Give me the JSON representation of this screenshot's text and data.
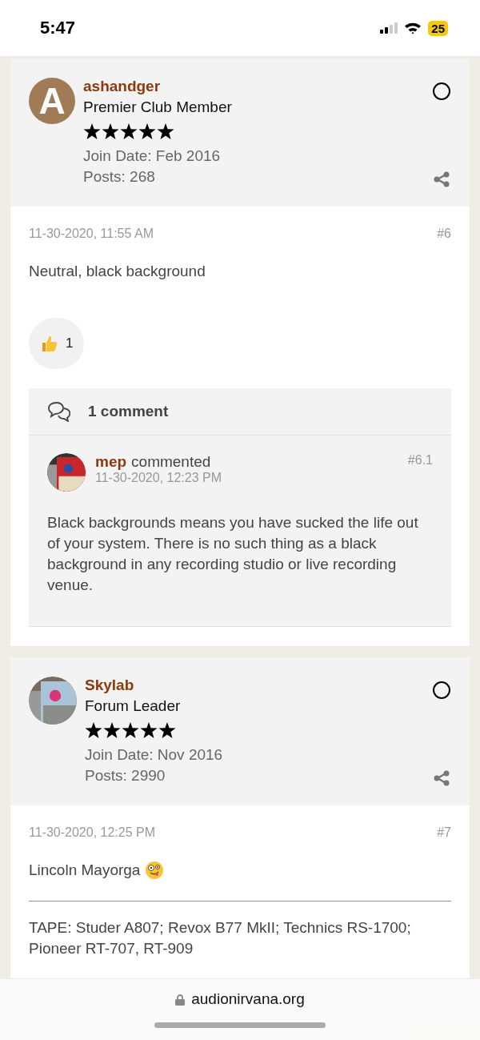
{
  "status_bar": {
    "time": "5:47",
    "battery": "25"
  },
  "posts": [
    {
      "selected": false,
      "author": {
        "name": "ashandger",
        "avatar": {
          "kind": "letter",
          "letter": "A"
        },
        "title": "Premier Club Member",
        "stars": 5,
        "join_date": "Join Date: Feb 2016",
        "post_count": "Posts: 268"
      },
      "date": "11-30-2020, 11:55 AM",
      "number": "#6",
      "body": [
        {
          "kind": "text",
          "text": "Neutral, black background"
        }
      ],
      "reaction": {
        "count": "1"
      },
      "comments": {
        "heading": "1 comment",
        "items": [
          {
            "author": "mep",
            "action": "commented",
            "date": "11-30-2020, 12:23 PM",
            "number": "#6.1",
            "text": "Black backgrounds means you have sucked the life out of your system. There is no such thing as a black background in any recording studio or live recording venue."
          }
        ]
      }
    },
    {
      "selected": false,
      "author": {
        "name": "Skylab",
        "title": "Forum Leader",
        "stars": 5,
        "join_date": "Join Date: Nov 2016",
        "post_count": "Posts: 2990"
      },
      "date": "11-30-2020, 12:25 PM",
      "number": "#7",
      "body": [
        {
          "kind": "text_emoji",
          "text": "Lincoln Mayorga"
        },
        {
          "kind": "signature",
          "text": "TAPE: Studer A807; Revox B77 MkII; Technics RS-1700; Pioneer RT-707, RT-909"
        }
      ]
    }
  ],
  "address_bar": {
    "url": "audionirvana.org"
  }
}
